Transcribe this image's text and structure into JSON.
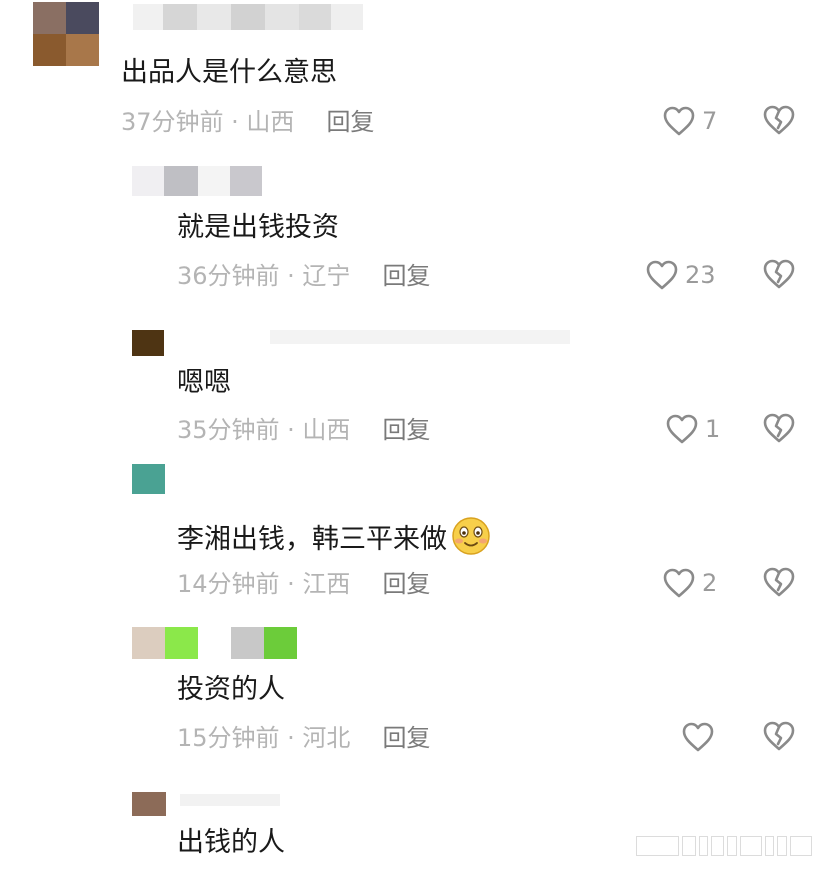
{
  "reply_label": "回复",
  "comments": [
    {
      "text": "出品人是什么意思",
      "time_location": "37分钟前 · 山西",
      "likes": "7"
    },
    {
      "text": "就是出钱投资",
      "time_location": "36分钟前 · 辽宁",
      "likes": "23"
    },
    {
      "text": "嗯嗯",
      "time_location": "35分钟前 · 山西",
      "likes": "1"
    },
    {
      "text": "李湘出钱，韩三平来做",
      "time_location": "14分钟前 · 江西",
      "likes": "2",
      "emoji": "smiling-face-emoji"
    },
    {
      "text": "投资的人",
      "time_location": "15分钟前 · 河北",
      "likes": ""
    },
    {
      "text": "出钱的人"
    }
  ],
  "icons": {
    "like": "heart-outline-icon",
    "dislike": "broken-heart-icon"
  },
  "colors": {
    "text": "#1a1a1a",
    "meta": "#b4b4b4",
    "reply": "#7a7a7a",
    "icon": "#8a8a8a"
  }
}
